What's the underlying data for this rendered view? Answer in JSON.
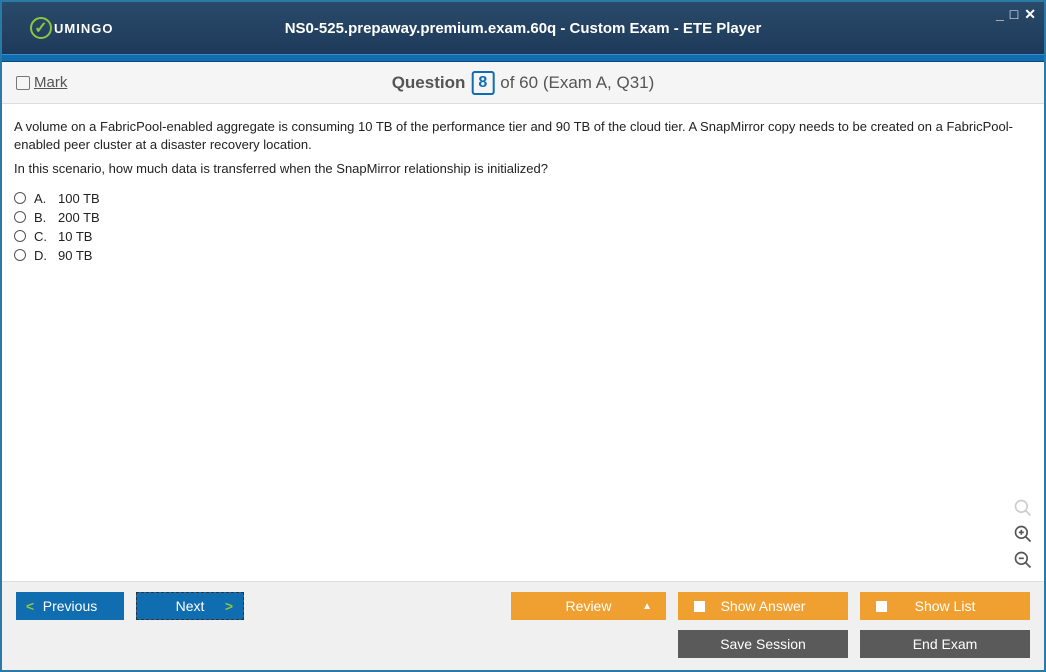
{
  "window": {
    "title": "NS0-525.prepaway.premium.exam.60q - Custom Exam - ETE Player",
    "logo_text": "UMINGO"
  },
  "question_bar": {
    "mark_label": "Mark",
    "question_word": "Question",
    "current_number": "8",
    "of_text": "of 60 (Exam A, Q31)"
  },
  "question": {
    "paragraph1": "A volume on a FabricPool-enabled aggregate is consuming 10 TB of the performance tier and 90 TB of the cloud tier. A SnapMirror copy needs to be created on a FabricPool-enabled peer cluster at a disaster recovery location.",
    "paragraph2": "In this scenario, how much data is transferred when the SnapMirror relationship is initialized?",
    "options": [
      {
        "letter": "A.",
        "text": "100 TB"
      },
      {
        "letter": "B.",
        "text": "200 TB"
      },
      {
        "letter": "C.",
        "text": "10 TB"
      },
      {
        "letter": "D.",
        "text": "90 TB"
      }
    ]
  },
  "footer": {
    "previous": "Previous",
    "next": "Next",
    "review": "Review",
    "show_answer": "Show Answer",
    "show_list": "Show List",
    "save_session": "Save Session",
    "end_exam": "End Exam"
  }
}
